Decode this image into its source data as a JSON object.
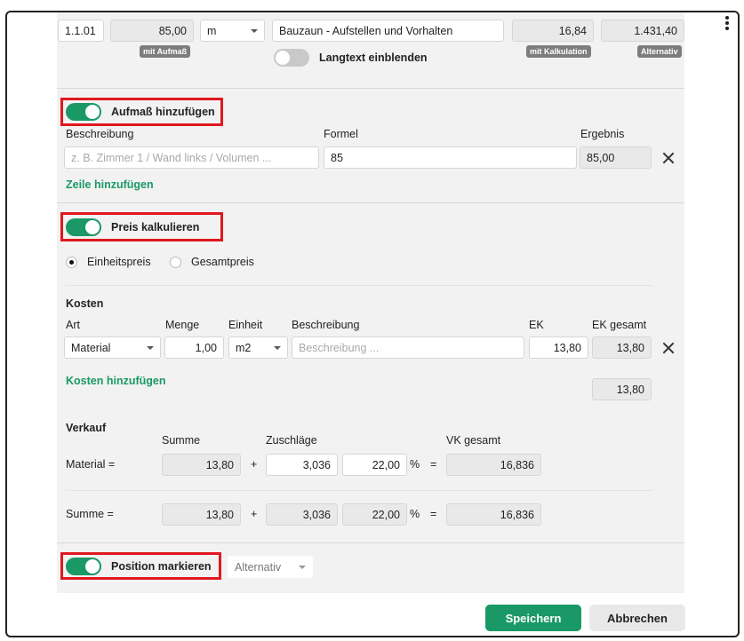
{
  "position": {
    "number": "1.1.01",
    "quantity": "85,00",
    "quantity_badge": "mit Aufmaß",
    "unit": "m",
    "title": "Bauzaun - Aufstellen und Vorhalten",
    "unit_price": "16,84",
    "unit_price_badge": "mit Kalkulation",
    "total": "1.431,40",
    "total_badge": "Alternativ",
    "longtext_toggle_label": "Langtext einblenden"
  },
  "aufmass": {
    "toggle_label": "Aufmaß hinzufügen",
    "col_description": "Beschreibung",
    "col_formula": "Formel",
    "col_result": "Ergebnis",
    "description_placeholder": "z. B. Zimmer 1 / Wand links / Volumen ...",
    "formula_value": "85",
    "result_value": "85,00",
    "add_row_link": "Zeile hinzufügen"
  },
  "kalkulation": {
    "toggle_label": "Preis kalkulieren",
    "radio_unit_price": "Einheitspreis",
    "radio_total_price": "Gesamtpreis",
    "costs_heading": "Kosten",
    "col_type": "Art",
    "col_quantity": "Menge",
    "col_unit": "Einheit",
    "col_description": "Beschreibung",
    "col_ek": "EK",
    "col_ek_total": "EK gesamt",
    "cost_row": {
      "type": "Material",
      "quantity": "1,00",
      "unit": "m2",
      "description_placeholder": "Beschreibung ...",
      "ek": "13,80",
      "ek_total": "13,80"
    },
    "add_costs_link": "Kosten hinzufügen",
    "costs_sum": "13,80",
    "sales_heading": "Verkauf",
    "col_sum": "Summe",
    "col_surcharges": "Zuschläge",
    "col_vk_total": "VK gesamt",
    "material_row": {
      "label": "Material =",
      "sum": "13,80",
      "plus": "+",
      "surcharge_amount": "3,036",
      "surcharge_percent": "22,00",
      "percent_sign": "%",
      "equals": "=",
      "vk_total": "16,836"
    },
    "summe_row": {
      "label": "Summe =",
      "sum": "13,80",
      "plus": "+",
      "surcharge_amount": "3,036",
      "surcharge_percent": "22,00",
      "percent_sign": "%",
      "equals": "=",
      "vk_total": "16,836"
    }
  },
  "markierung": {
    "toggle_label": "Position markieren",
    "select_value": "Alternativ"
  },
  "footer": {
    "save_label": "Speichern",
    "cancel_label": "Abbrechen"
  },
  "colors": {
    "accent": "#1a9966",
    "highlight": "#e0181e",
    "panel": "#f2f2f2"
  }
}
